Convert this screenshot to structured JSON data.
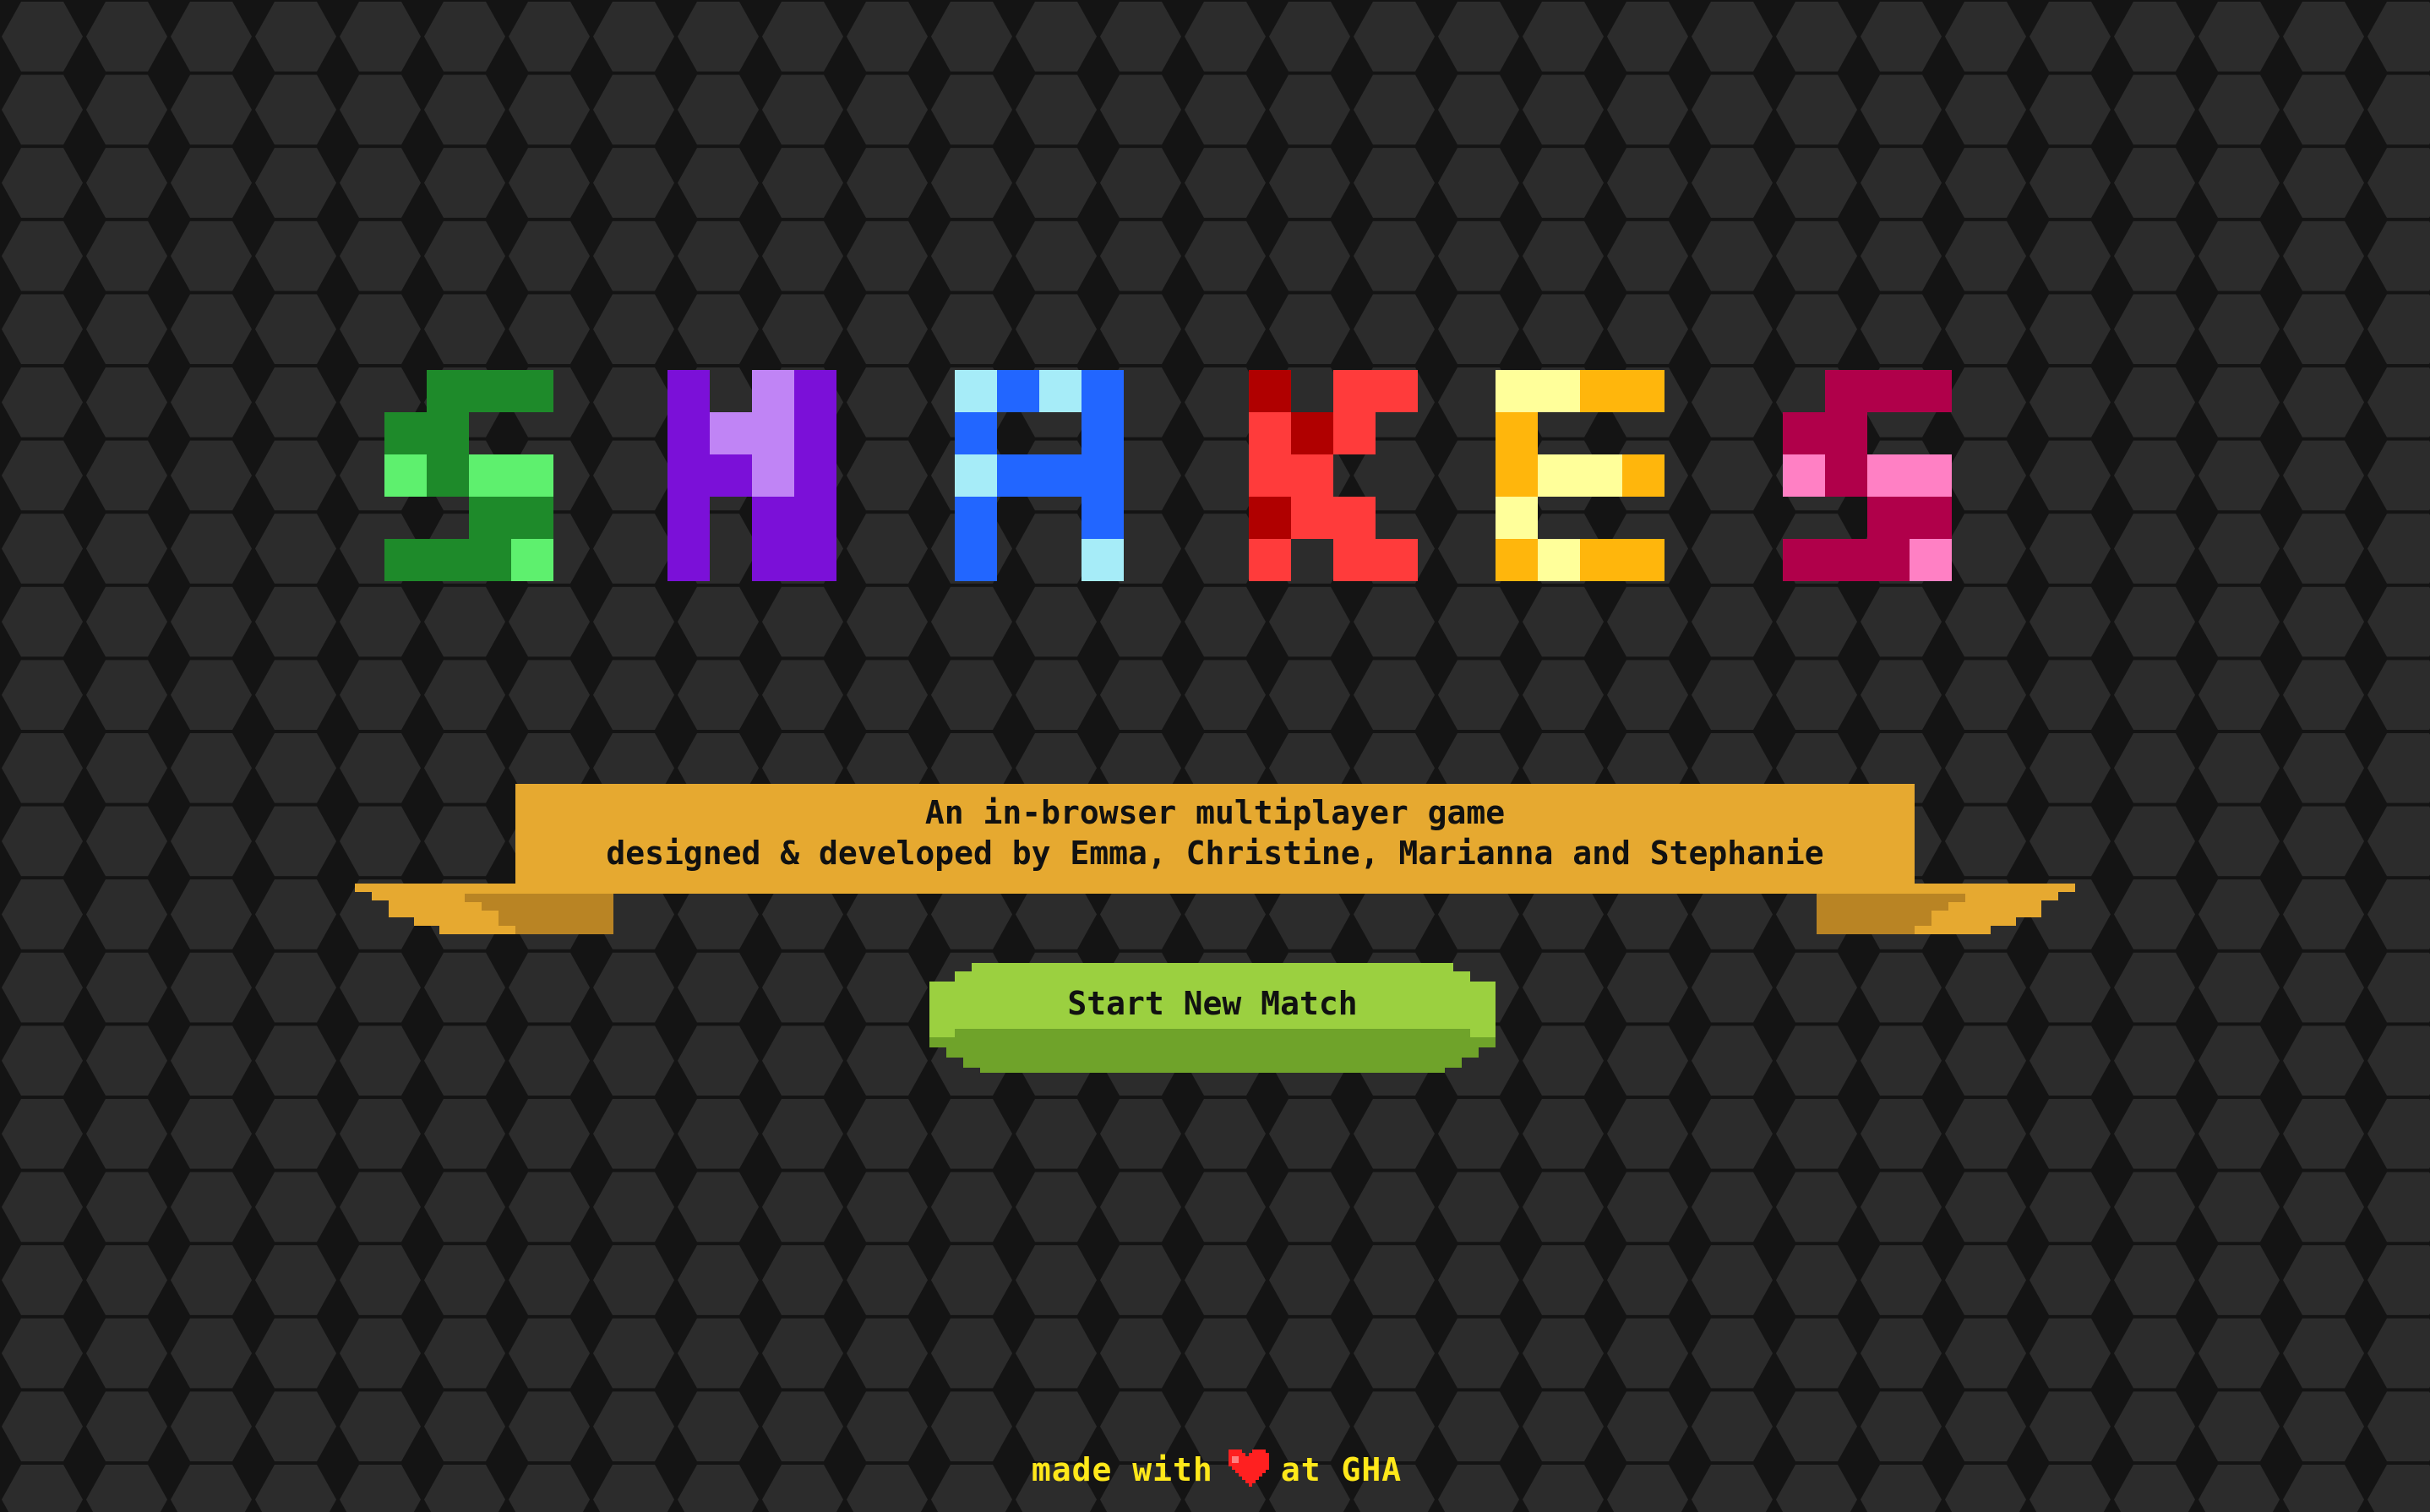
{
  "game": {
    "title": "SNAKES",
    "title_letters": [
      {
        "char": "S",
        "color": "#1e8a2a",
        "accent": "#5ef06e"
      },
      {
        "char": "N",
        "color": "#7b10d8",
        "accent": "#c084f5"
      },
      {
        "char": "A",
        "color": "#2266ff",
        "accent": "#a6ecf8"
      },
      {
        "char": "K",
        "color": "#ff3b3b",
        "accent": "#b00000"
      },
      {
        "char": "E",
        "color": "#ffb60c",
        "accent": "#ffff9a"
      },
      {
        "char": "S",
        "color": "#b0004a",
        "accent": "#ff80c4"
      }
    ]
  },
  "banner": {
    "line1": "An in-browser multiplayer game",
    "line2": "designed & developed by Emma, Christine, Marianna and Stephanie",
    "color": "#e6a930"
  },
  "start_button": {
    "label": "Start New Match",
    "color": "#9bd040"
  },
  "footer": {
    "made_with": "made with",
    "at": "at GHA",
    "heart_icon": "heart-icon",
    "text_color": "#ffe81a",
    "heart_color": "#ff2020"
  },
  "background": {
    "pattern": "hexagon",
    "base_color": "#1a1a1a",
    "hex_color": "#2c2c2c"
  }
}
